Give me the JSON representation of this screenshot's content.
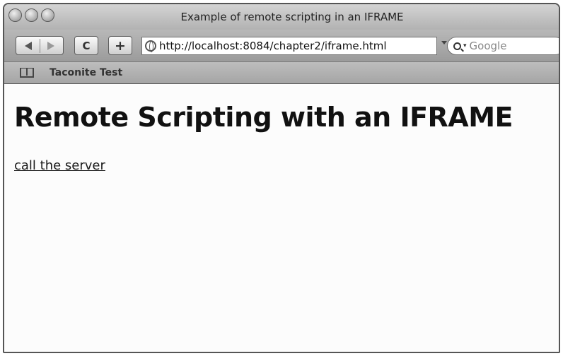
{
  "window": {
    "title": "Example of remote scripting in an IFRAME"
  },
  "toolbar": {
    "back_icon": "back-arrow-icon",
    "forward_icon": "forward-arrow-icon",
    "reload_label": "C",
    "add_bookmark_label": "+",
    "address_url": "http://localhost:8084/chapter2/iframe.html",
    "search_placeholder": "Google"
  },
  "bookmarks_bar": {
    "items": [
      {
        "label": "Taconite Test"
      }
    ]
  },
  "page": {
    "heading": "Remote Scripting with an IFRAME",
    "link_text": "call the server"
  }
}
